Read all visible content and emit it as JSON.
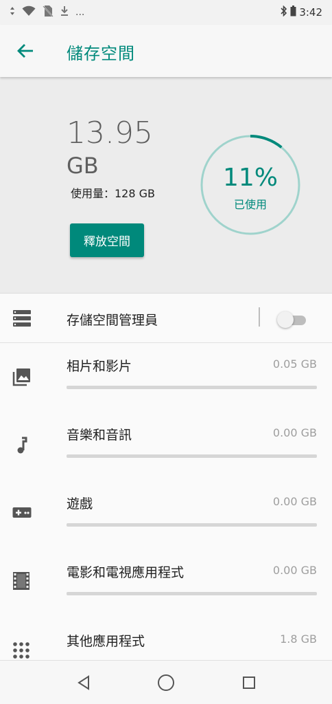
{
  "status_bar": {
    "time": "3:42",
    "overflow": "..."
  },
  "app_bar": {
    "title": "儲存空間",
    "back_icon": "arrow-back-icon"
  },
  "summary": {
    "used_value": "13.95",
    "used_unit": "GB",
    "total_text": "使用量：128 GB",
    "percent_text": "11%",
    "percent_label": "已使用",
    "percent_used": 0.11,
    "free_button": "釋放空間"
  },
  "storage_manager": {
    "label": "存儲空間管理員",
    "toggle_on": false
  },
  "categories": [
    {
      "label": "相片和影片",
      "size": "0.05 GB",
      "icon": "photo-icon"
    },
    {
      "label": "音樂和音訊",
      "size": "0.00 GB",
      "icon": "music-note-icon"
    },
    {
      "label": "遊戲",
      "size": "0.00 GB",
      "icon": "gamepad-icon"
    },
    {
      "label": "電影和電視應用程式",
      "size": "0.00 GB",
      "icon": "film-icon"
    },
    {
      "label": "其他應用程式",
      "size": "1.8 GB",
      "icon": "apps-grid-icon"
    }
  ],
  "colors": {
    "accent": "#00897b",
    "ring_track": "#9fd3cc",
    "bar_track": "#d6d6d6"
  },
  "nav": {
    "back_icon": "nav-back-icon",
    "home_icon": "nav-home-icon",
    "recents_icon": "nav-recents-icon"
  }
}
